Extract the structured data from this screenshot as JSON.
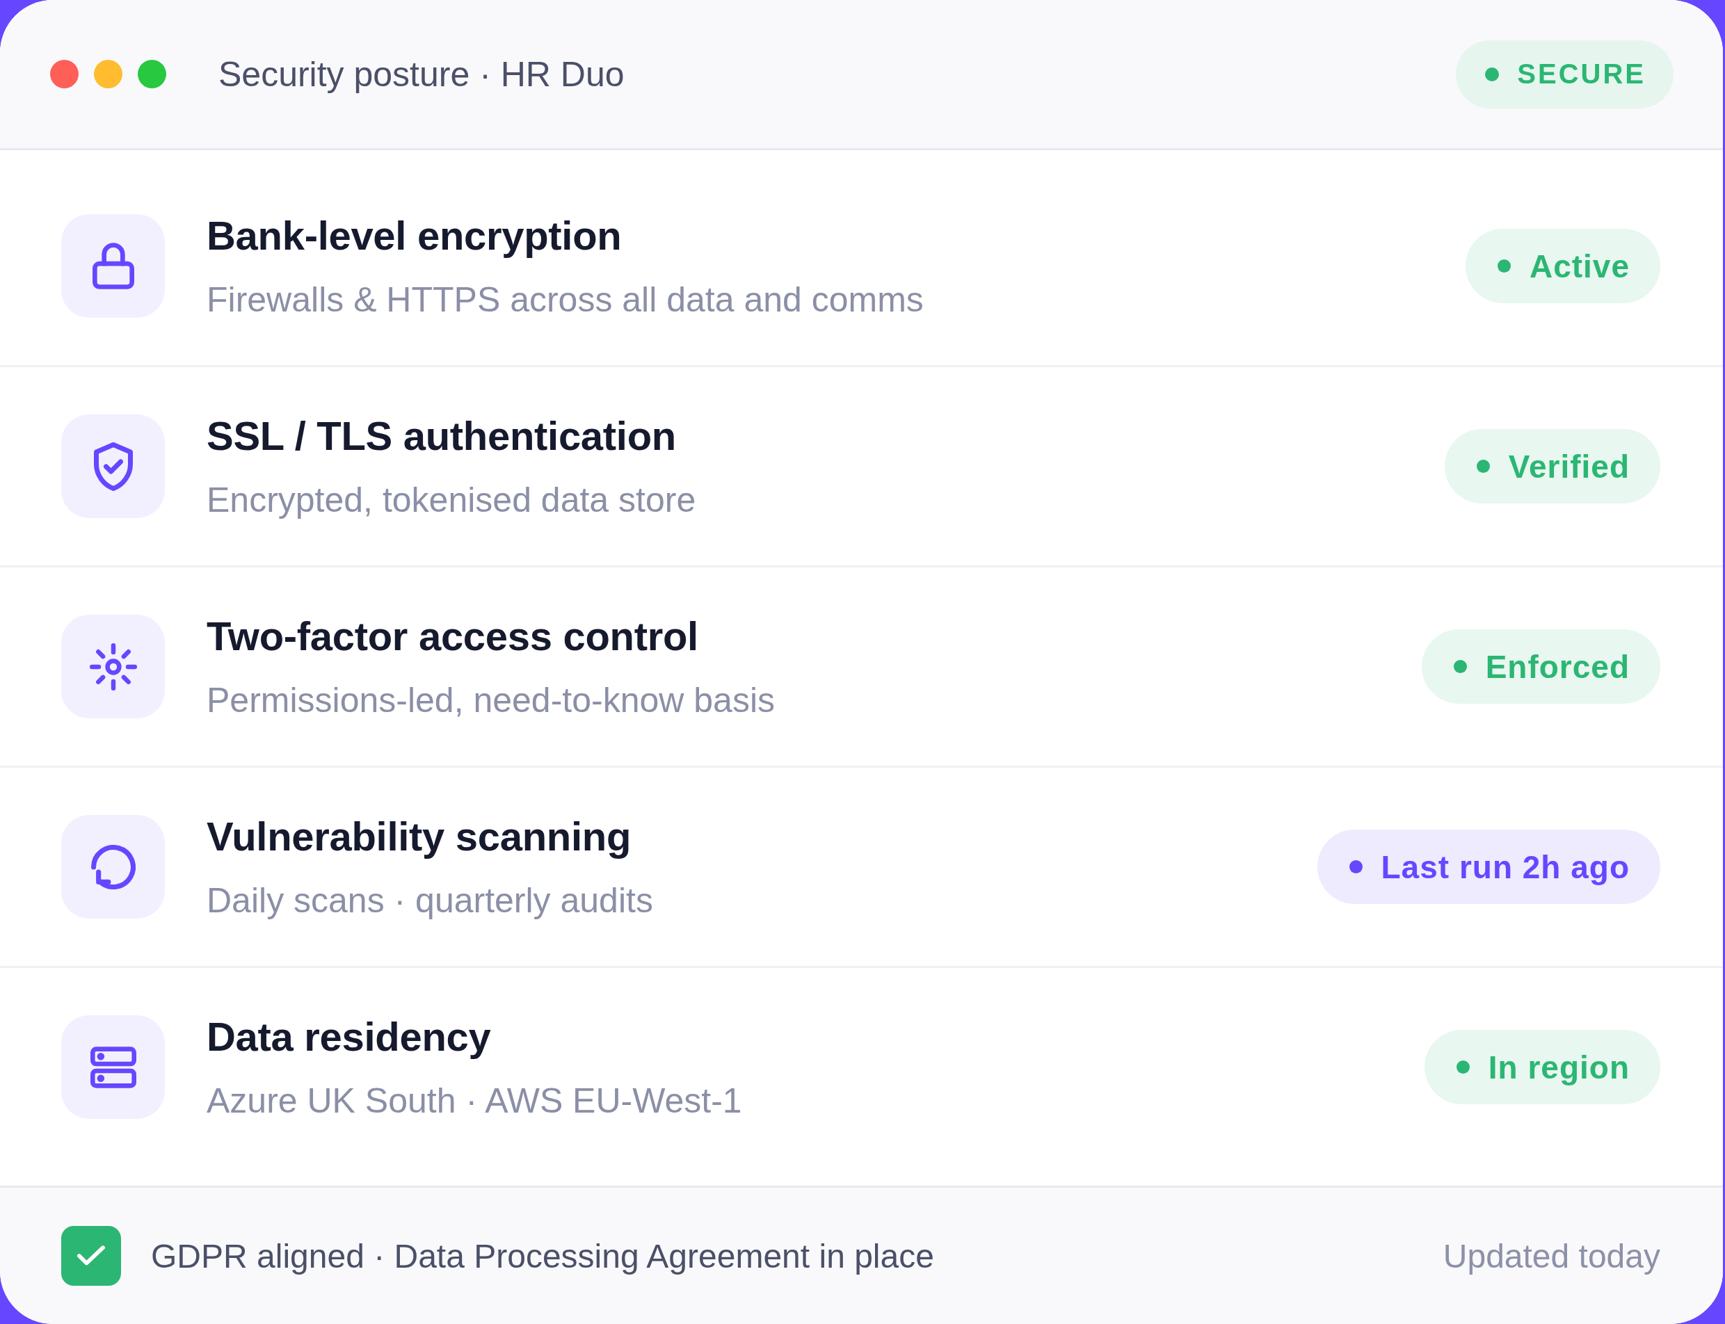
{
  "window": {
    "title": "Security posture · HR Duo",
    "status": {
      "label": "SECURE",
      "color": "#2bb673"
    }
  },
  "features": [
    {
      "title": "Bank-level encryption",
      "detail": "Firewalls & HTTPS across all data and comms",
      "status": {
        "label": "Active",
        "color": "#2bb673"
      }
    },
    {
      "title": "SSL / TLS authentication",
      "detail": "Encrypted, tokenised data store",
      "status": {
        "label": "Verified",
        "color": "#2bb673"
      }
    },
    {
      "title": "Two-factor access control",
      "detail": "Permissions-led, need-to-know basis",
      "status": {
        "label": "Enforced",
        "color": "#2bb673"
      }
    },
    {
      "title": "Vulnerability scanning",
      "detail": "Daily scans · quarterly audits",
      "status": {
        "label": "Last run 2h ago",
        "color": "#6647ff"
      }
    },
    {
      "title": "Data residency",
      "detail": "Azure UK South · AWS EU-West-1",
      "status": {
        "label": "In region",
        "color": "#2bb673"
      }
    }
  ],
  "footer": {
    "note": "GDPR aligned · Data Processing Agreement in place",
    "updated": "Updated today"
  }
}
